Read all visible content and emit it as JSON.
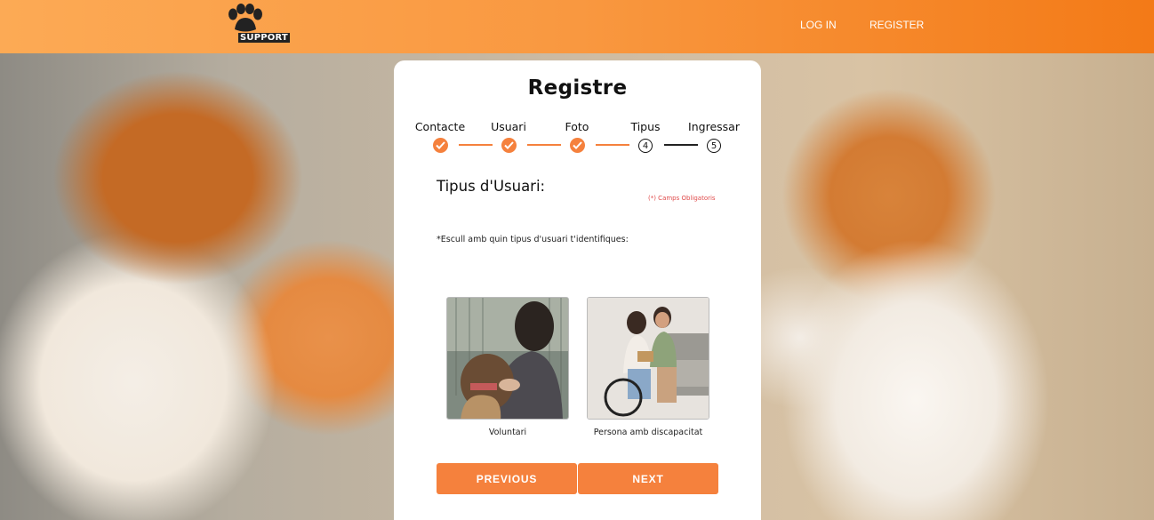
{
  "header": {
    "logo_text": "SUPPORT",
    "login_label": "LOG IN",
    "register_label": "REGISTER"
  },
  "card": {
    "title": "Registre",
    "steps": [
      {
        "label": "Contacte",
        "state": "done"
      },
      {
        "label": "Usuari",
        "state": "done"
      },
      {
        "label": "Foto",
        "state": "done"
      },
      {
        "label": "Tipus",
        "state": "current",
        "number": "4"
      },
      {
        "label": "Ingressar",
        "state": "pending",
        "number": "5"
      }
    ],
    "section_title": "Tipus d'Usuari:",
    "required_note": "(*) Camps Obligatoris",
    "prompt": "*Escull amb quin tipus d'usuari t'identifiques:",
    "choices": [
      {
        "label": "Voluntari",
        "icon": "volunteer-photo"
      },
      {
        "label": "Persona amb discapacitat",
        "icon": "disabled-person-photo"
      }
    ],
    "previous_label": "PREVIOUS",
    "next_label": "NEXT"
  },
  "colors": {
    "accent": "#f5813d",
    "header_start": "#fcaa55",
    "header_end": "#f37a17",
    "required": "#e04b4b"
  }
}
